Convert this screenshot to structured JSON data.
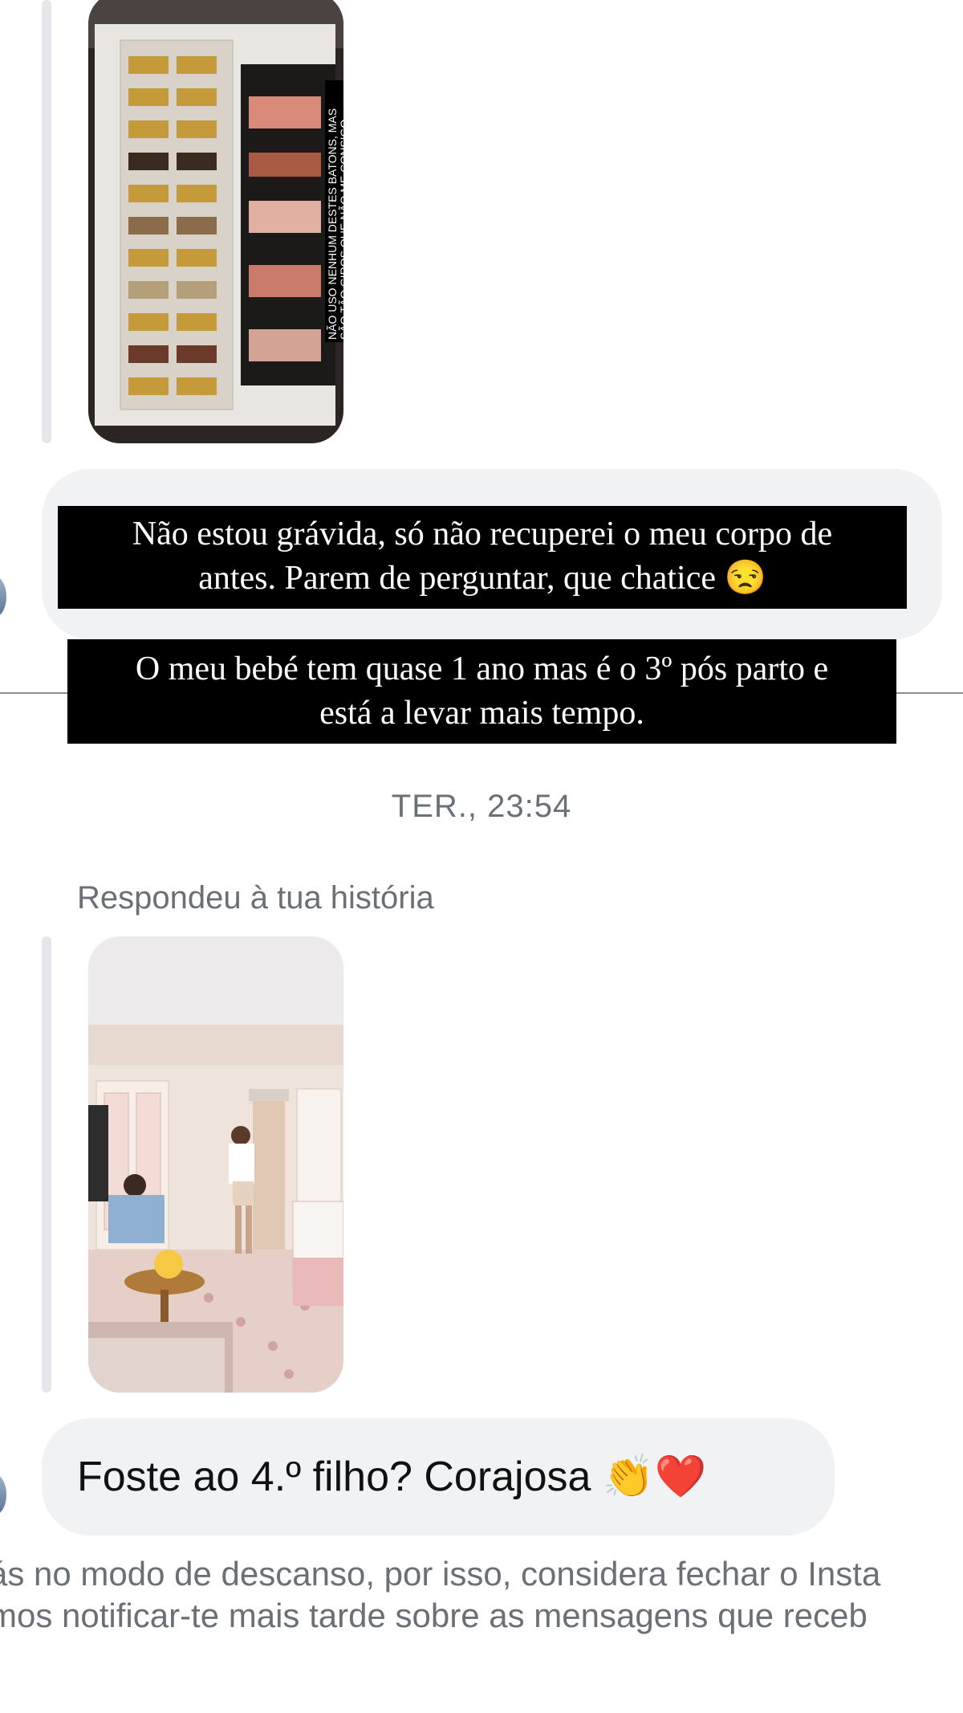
{
  "thread": {
    "story1": {
      "overlay_text": "NÃO USO NENHUM DESTES BATONS, MAS SÃO TÃO GIROS QUE NÃO ME CONSIGO DESFAZER 😂🙈"
    },
    "message1": {
      "caption_line1": "Não estou grávida, só não recuperei o meu corpo de",
      "caption_line2": "antes. Parem de perguntar, que chatice 😒",
      "caption2_line1": "O meu bebé tem quase 1 ano mas é o 3º pós parto e",
      "caption2_line2": "está a levar mais tempo."
    },
    "timestamp": "TER., 23:54",
    "replied_label": "Respondeu à tua história",
    "message2": {
      "text": "Foste ao 4.º filho? Corajosa 👏❤️"
    },
    "rest_notice": {
      "line1": "ás no modo de descanso, por isso, considera fechar o Insta",
      "line2": "mos notificar-te mais tarde sobre as mensagens que receb"
    }
  }
}
